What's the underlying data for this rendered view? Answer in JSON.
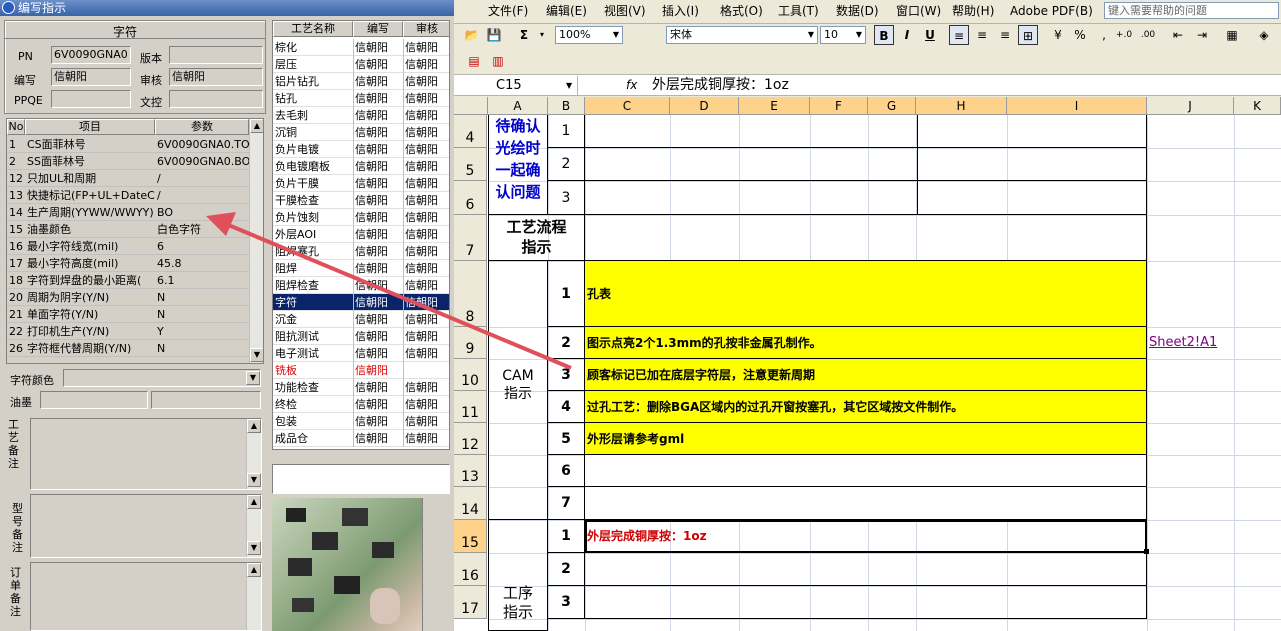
{
  "left": {
    "title": "编写指示",
    "char_group": "字符",
    "fields": {
      "pn_label": "PN",
      "pn_value": "6V0090GNA0",
      "version_label": "版本",
      "version_value": "",
      "author_label": "编写",
      "author_value": "信朝阳",
      "review_label": "审核",
      "review_value": "信朝阳",
      "ppqe_label": "PPQE",
      "ppqe_value": "",
      "control_label": "文控",
      "control_value": ""
    },
    "param_headers": {
      "no": "No",
      "item": "项目",
      "param": "参数"
    },
    "params": [
      {
        "no": "1",
        "item": "CS面菲林号",
        "value": "6V0090GNA0.TO"
      },
      {
        "no": "2",
        "item": "SS面菲林号",
        "value": "6V0090GNA0.BO"
      },
      {
        "no": "12",
        "item": "只加UL和周期",
        "value": "/"
      },
      {
        "no": "13",
        "item": "快捷标记(FP+UL+DateCo",
        "value": "/"
      },
      {
        "no": "14",
        "item": "生产周期(YYWW/WWYY)",
        "value": "BO"
      },
      {
        "no": "15",
        "item": "油墨颜色",
        "value": "白色字符"
      },
      {
        "no": "16",
        "item": "最小字符线宽(mil)",
        "value": "6"
      },
      {
        "no": "17",
        "item": "最小字符高度(mil)",
        "value": "45.8"
      },
      {
        "no": "18",
        "item": "字符到焊盘的最小距离(",
        "value": "6.1"
      },
      {
        "no": "20",
        "item": "周期为阴字(Y/N)",
        "value": "N"
      },
      {
        "no": "21",
        "item": "单面字符(Y/N)",
        "value": "N"
      },
      {
        "no": "22",
        "item": "打印机生产(Y/N)",
        "value": "Y"
      },
      {
        "no": "26",
        "item": "字符框代替周期(Y/N)",
        "value": "N"
      }
    ],
    "char_color_label": "字符颜色",
    "ink_label": "油墨",
    "remark1_label": "工艺备注",
    "remark2_label": "型号备注",
    "remark3_label": "订单备注",
    "process_headers": {
      "name": "工艺名称",
      "author": "编写",
      "review": "审核"
    },
    "processes": [
      {
        "name": "棕化",
        "author": "信朝阳",
        "review": "信朝阳",
        "state": "normal"
      },
      {
        "name": "层压",
        "author": "信朝阳",
        "review": "信朝阳",
        "state": "normal"
      },
      {
        "name": "铝片钻孔",
        "author": "信朝阳",
        "review": "信朝阳",
        "state": "normal"
      },
      {
        "name": "钻孔",
        "author": "信朝阳",
        "review": "信朝阳",
        "state": "normal"
      },
      {
        "name": "去毛刺",
        "author": "信朝阳",
        "review": "信朝阳",
        "state": "normal"
      },
      {
        "name": "沉铜",
        "author": "信朝阳",
        "review": "信朝阳",
        "state": "normal"
      },
      {
        "name": "负片电镀",
        "author": "信朝阳",
        "review": "信朝阳",
        "state": "normal"
      },
      {
        "name": "负电镀磨板",
        "author": "信朝阳",
        "review": "信朝阳",
        "state": "normal"
      },
      {
        "name": "负片干膜",
        "author": "信朝阳",
        "review": "信朝阳",
        "state": "normal"
      },
      {
        "name": "干膜检查",
        "author": "信朝阳",
        "review": "信朝阳",
        "state": "normal"
      },
      {
        "name": "负片蚀刻",
        "author": "信朝阳",
        "review": "信朝阳",
        "state": "normal"
      },
      {
        "name": "外层AOI",
        "author": "信朝阳",
        "review": "信朝阳",
        "state": "normal"
      },
      {
        "name": "阻焊塞孔",
        "author": "信朝阳",
        "review": "信朝阳",
        "state": "normal"
      },
      {
        "name": "阻焊",
        "author": "信朝阳",
        "review": "信朝阳",
        "state": "normal"
      },
      {
        "name": "阻焊检查",
        "author": "信朝阳",
        "review": "信朝阳",
        "state": "normal"
      },
      {
        "name": "字符",
        "author": "信朝阳",
        "review": "信朝阳",
        "state": "selected"
      },
      {
        "name": "沉金",
        "author": "信朝阳",
        "review": "信朝阳",
        "state": "normal"
      },
      {
        "name": "阻抗测试",
        "author": "信朝阳",
        "review": "信朝阳",
        "state": "normal"
      },
      {
        "name": "电子测试",
        "author": "信朝阳",
        "review": "信朝阳",
        "state": "normal"
      },
      {
        "name": "铣板",
        "author": "信朝阳",
        "review": "",
        "state": "red"
      },
      {
        "name": "功能检查",
        "author": "信朝阳",
        "review": "信朝阳",
        "state": "normal"
      },
      {
        "name": "终检",
        "author": "信朝阳",
        "review": "信朝阳",
        "state": "normal"
      },
      {
        "name": "包装",
        "author": "信朝阳",
        "review": "信朝阳",
        "state": "normal"
      },
      {
        "name": "成品仓",
        "author": "信朝阳",
        "review": "信朝阳",
        "state": "normal"
      }
    ]
  },
  "excel": {
    "menu": [
      "文件(F)",
      "编辑(E)",
      "视图(V)",
      "插入(I)",
      "格式(O)",
      "工具(T)",
      "数据(D)",
      "窗口(W)",
      "帮助(H)",
      "Adobe PDF(B)"
    ],
    "help_placeholder": "键入需要帮助的问题",
    "zoom": "100%",
    "font": "宋体",
    "size": "10",
    "name_box": "C15",
    "formula": "外层完成铜厚按：1oz",
    "columns": [
      "A",
      "B",
      "C",
      "D",
      "E",
      "F",
      "G",
      "H",
      "I",
      "J",
      "K"
    ],
    "rows": [
      "4",
      "5",
      "6",
      "7",
      "8",
      "9",
      "10",
      "11",
      "12",
      "13",
      "14",
      "15",
      "16",
      "17"
    ],
    "cells": {
      "confirm_title": "待确认光绘时一起确认问题",
      "flow_title": "工艺流程指示",
      "cam_title": "CAM指示",
      "proc_title": "工序指示",
      "b_confirm": [
        "1",
        "2",
        "3"
      ],
      "b_cam": [
        "1",
        "2",
        "3",
        "4",
        "5",
        "6",
        "7"
      ],
      "b_proc": [
        "1",
        "2",
        "3"
      ],
      "cam_items": [
        "孔表",
        "图示点亮2个1.3mm的孔按非金属孔制作。",
        "顾客标记已加在底层字符层，注意更新周期",
        "过孔工艺：删除BGA区域内的过孔开窗按塞孔，其它区域按文件制作。",
        "外形层请参考gml",
        "",
        ""
      ],
      "proc_item1": "外层完成铜厚按：1oz",
      "link": "Sheet2!A1"
    },
    "colors": {
      "yellow": "#ffff00",
      "blue_text": "#0000cc",
      "red_text": "#cc0000",
      "link": "#800080"
    }
  }
}
